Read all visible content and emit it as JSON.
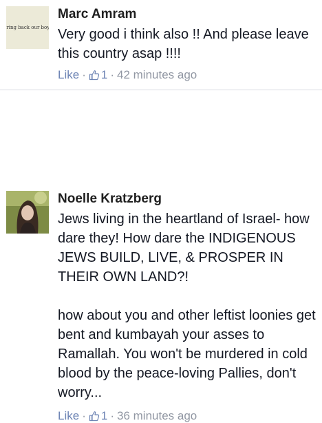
{
  "comments": [
    {
      "author": "Marc Amram",
      "avatar_text": "Bring back our boys",
      "text": "Very good i think also !! And please leave this country asap !!!!",
      "like_label": "Like",
      "like_count": "1",
      "time": "42 minutes ago"
    },
    {
      "author": "Noelle Kratzberg",
      "text_p1": "Jews living in the heartland of Israel- how dare they! How dare the INDIGENOUS JEWS BUILD, LIVE, & PROSPER IN THEIR OWN LAND?!",
      "text_p2": "how about you and other leftist loonies get bent and kumbayah your asses to Ramallah. You won't be murdered in cold blood by the peace-loving Pallies, don't worry...",
      "like_label": "Like",
      "like_count": "1",
      "time": "36 minutes ago"
    }
  ],
  "separator": "·",
  "colors": {
    "link": "#6d84b4",
    "meta": "#9197a3",
    "divider": "#d8dbe2"
  },
  "icons": {
    "like": "thumbs-up-icon"
  }
}
